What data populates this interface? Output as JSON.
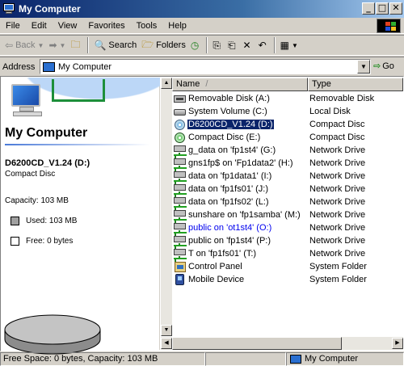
{
  "window": {
    "title": "My Computer",
    "controls": {
      "minimize": "_",
      "maximize": "□",
      "close": "✕"
    }
  },
  "menu": [
    "File",
    "Edit",
    "View",
    "Favorites",
    "Tools",
    "Help"
  ],
  "toolbar": {
    "back": "Back",
    "forward_icon": "➡",
    "search": "Search",
    "folders": "Folders",
    "views_icon": "▦"
  },
  "address": {
    "label": "Address",
    "value": "My Computer",
    "go": "Go"
  },
  "info_pane": {
    "title": "My Computer",
    "selected_name": "D6200CD_V1.24 (D:)",
    "selected_type": "Compact Disc",
    "capacity": "Capacity: 103 MB",
    "used": "Used: 103 MB",
    "free": "Free: 0 bytes",
    "used_color": "#a0a0a0",
    "free_color": "#ffffff"
  },
  "columns": {
    "name": "Name",
    "sort_indicator": "/",
    "type": "Type"
  },
  "items": [
    {
      "name": "Removable Disk (A:)",
      "type": "Removable Disk",
      "icon": "floppy-icon"
    },
    {
      "name": "System Volume (C:)",
      "type": "Local Disk",
      "icon": "hard-disk-icon"
    },
    {
      "name": "D6200CD_V1.24 (D:)",
      "type": "Compact Disc",
      "icon": "cd-drive-icon",
      "selected": true
    },
    {
      "name": "Compact Disc (E:)",
      "type": "Compact Disc",
      "icon": "cd-drive-icon"
    },
    {
      "name": "g_data on 'fp1st4' (G:)",
      "type": "Network Drive",
      "icon": "network-drive-icon"
    },
    {
      "name": "gns1fp$ on 'Fp1data2' (H:)",
      "type": "Network Drive",
      "icon": "network-drive-icon"
    },
    {
      "name": "data on 'fp1data1' (I:)",
      "type": "Network Drive",
      "icon": "network-drive-icon"
    },
    {
      "name": "data on 'fp1fs01' (J:)",
      "type": "Network Drive",
      "icon": "network-drive-icon"
    },
    {
      "name": "data on 'fp1fs02' (L:)",
      "type": "Network Drive",
      "icon": "network-drive-icon"
    },
    {
      "name": "sunshare on 'fp1samba' (M:)",
      "type": "Network Drive",
      "icon": "network-drive-icon"
    },
    {
      "name": "public on 'ot1st4' (O:)",
      "type": "Network Drive",
      "icon": "network-drive-icon",
      "link": true
    },
    {
      "name": "public on 'fp1st4' (P:)",
      "type": "Network Drive",
      "icon": "network-drive-icon"
    },
    {
      "name": "T on 'fp1fs01' (T:)",
      "type": "Network Drive",
      "icon": "network-drive-icon"
    },
    {
      "name": "Control Panel",
      "type": "System Folder",
      "icon": "control-panel-icon"
    },
    {
      "name": "Mobile Device",
      "type": "System Folder",
      "icon": "mobile-device-icon"
    }
  ],
  "status": {
    "left": "Free Space: 0 bytes, Capacity: 103 MB",
    "right": "My Computer"
  }
}
